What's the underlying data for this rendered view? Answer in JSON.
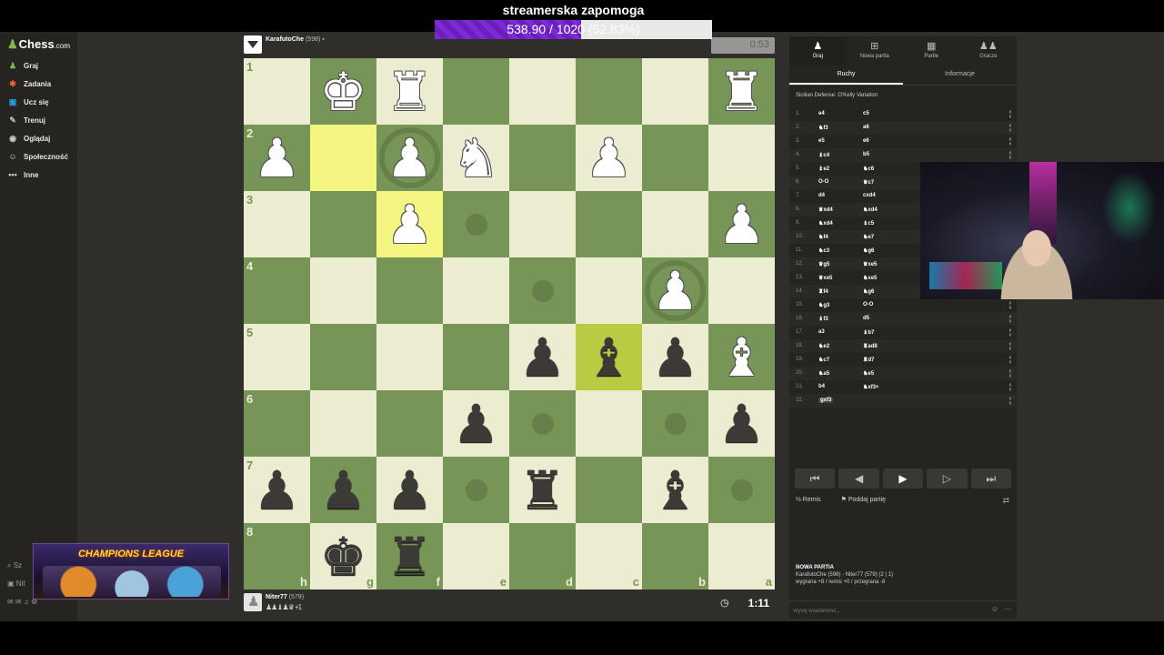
{
  "overlay": {
    "donation_title": "streamerska zapomoga",
    "donation_text": "538.90 / 1020 (52.83%)",
    "donation_progress": 0.5283,
    "banner_text": "CHAMPIONS LEAGUE"
  },
  "sidebar": {
    "logo": "Chess",
    "logo_suffix": ".com",
    "items": [
      {
        "label": "Graj",
        "icon": "chessboard-icon"
      },
      {
        "label": "Zadania",
        "icon": "puzzle-icon"
      },
      {
        "label": "Ucz się",
        "icon": "learn-icon"
      },
      {
        "label": "Trenuj",
        "icon": "train-icon"
      },
      {
        "label": "Oglądaj",
        "icon": "watch-icon"
      },
      {
        "label": "Społeczność",
        "icon": "community-icon"
      },
      {
        "label": "Inne",
        "icon": "more-icon"
      }
    ],
    "bottom_search": "Sz",
    "bottom_user": "Nit"
  },
  "top_player": {
    "name": "KarafutoChe",
    "rating": "(598)",
    "clock": "0:53"
  },
  "bottom_player": {
    "name": "Niter77",
    "rating": "(579)",
    "clock": "1:11",
    "captured": "♟♟♝♟♛ +1"
  },
  "board": {
    "ranks": [
      "1",
      "2",
      "3",
      "4",
      "5",
      "6",
      "7",
      "8"
    ],
    "files": [
      "h",
      "g",
      "f",
      "e",
      "d",
      "c",
      "b",
      "a"
    ],
    "rows": [
      [
        "",
        "wK",
        "wR",
        "",
        "",
        "",
        "",
        "wR"
      ],
      [
        "wP",
        "",
        "wP",
        "wN",
        "",
        "wP",
        "",
        ""
      ],
      [
        "",
        "",
        "wP",
        "",
        "",
        "",
        "",
        "wP"
      ],
      [
        "",
        "",
        "",
        "",
        "",
        "",
        "wP",
        ""
      ],
      [
        "",
        "",
        "",
        "",
        "bP",
        "bB",
        "bP",
        "wB"
      ],
      [
        "",
        "",
        "",
        "bP",
        "",
        "",
        "",
        "bP"
      ],
      [
        "bP",
        "bP",
        "bP",
        "",
        "bR",
        "",
        "bB",
        ""
      ],
      [
        "",
        "bK",
        "bR",
        "",
        "",
        "",
        "",
        ""
      ]
    ],
    "highlights": [
      [
        1,
        1
      ],
      [
        2,
        2
      ],
      [
        4,
        5
      ]
    ],
    "dots": [
      [
        2,
        3
      ],
      [
        3,
        4
      ],
      [
        5,
        4
      ],
      [
        5,
        6
      ],
      [
        6,
        3
      ],
      [
        6,
        7
      ]
    ],
    "rings": [
      [
        1,
        2
      ],
      [
        3,
        6
      ]
    ]
  },
  "panel": {
    "tabs": [
      {
        "label": "Graj",
        "icon": "play-icon"
      },
      {
        "label": "Nowa partia",
        "icon": "new-game-icon"
      },
      {
        "label": "Partie",
        "icon": "games-icon"
      },
      {
        "label": "Gracze",
        "icon": "players-icon"
      }
    ],
    "subtabs": [
      "Ruchy",
      "Informacje"
    ],
    "opening": "Sicilian Defense: O'Kelly Variation",
    "moves": [
      {
        "n": "1.",
        "w": "e4",
        "b": "c5"
      },
      {
        "n": "2.",
        "w": "♞f3",
        "b": "a6"
      },
      {
        "n": "3.",
        "w": "e5",
        "b": "e6"
      },
      {
        "n": "4.",
        "w": "♝c4",
        "b": "b5"
      },
      {
        "n": "5.",
        "w": "♝e2",
        "b": "♞c6"
      },
      {
        "n": "6.",
        "w": "O-O",
        "b": "♛c7"
      },
      {
        "n": "7.",
        "w": "d4",
        "b": "cxd4"
      },
      {
        "n": "8.",
        "w": "♛xd4",
        "b": "♞xd4"
      },
      {
        "n": "9.",
        "w": "♞xd4",
        "b": "♝c5"
      },
      {
        "n": "10.",
        "w": "♞f4",
        "b": "♞e7"
      },
      {
        "n": "11.",
        "w": "♞c3",
        "b": "♞g6"
      },
      {
        "n": "12.",
        "w": "♛g5",
        "b": "♛xe5"
      },
      {
        "n": "13.",
        "w": "♛xe5",
        "b": "♞xe5"
      },
      {
        "n": "14.",
        "w": "♜f4",
        "b": "♞g6"
      },
      {
        "n": "15.",
        "w": "♞g3",
        "b": "O-O"
      },
      {
        "n": "16.",
        "w": "♝f3",
        "b": "d5"
      },
      {
        "n": "17.",
        "w": "a3",
        "b": "♝b7"
      },
      {
        "n": "18.",
        "w": "♞e2",
        "b": "♜ad8"
      },
      {
        "n": "19.",
        "w": "♞c7",
        "b": "♜d7"
      },
      {
        "n": "20.",
        "w": "♞a5",
        "b": "♞e5"
      },
      {
        "n": "21.",
        "w": "b4",
        "b": "♞xf3+"
      },
      {
        "n": "22.",
        "w": "gxf3",
        "b": ""
      }
    ],
    "controls": [
      "⏮",
      "◀",
      "▶",
      "▷",
      "⏭"
    ],
    "draw_label": "Remis",
    "resign_label": "Poddaj partię",
    "newgame_header": "NOWA PARTIA",
    "newgame_players": "KarafutoChe (598) - Niter77 (579) (2 | 1)",
    "newgame_stats": "wygrana +8 / remis +0 / przegrana -8",
    "chat_placeholder": "Wyślij wiadomość..."
  },
  "colors": {
    "board_light": "#ebecd0",
    "board_dark": "#779556",
    "accent": "#81b64c",
    "donation_fill": "#7d2ad6"
  }
}
